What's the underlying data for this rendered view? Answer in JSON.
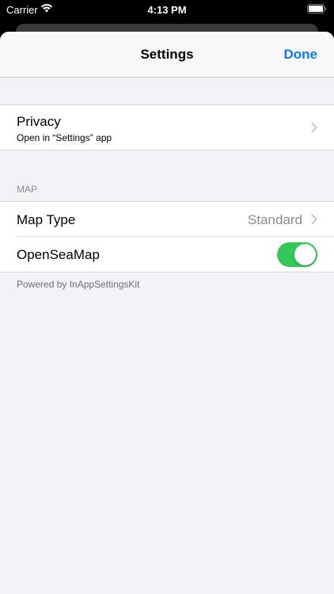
{
  "status_bar": {
    "carrier": "Carrier",
    "time": "4:13 PM",
    "icons": [
      "wifi-icon",
      "battery-icon"
    ]
  },
  "nav": {
    "title": "Settings",
    "done_label": "Done"
  },
  "privacy": {
    "title": "Privacy",
    "subtitle": "Open in “Settings” app",
    "icon": "chevron-right-icon"
  },
  "map_section": {
    "header": "MAP",
    "map_type": {
      "label": "Map Type",
      "value": "Standard",
      "icon": "chevron-right-icon"
    },
    "open_sea_map": {
      "label": "OpenSeaMap",
      "enabled": true
    }
  },
  "footer": "Powered by InAppSettingsKit",
  "colors": {
    "accent": "#0a7af5",
    "toggle_on": "#34c759",
    "background": "#f2f2f7",
    "secondary_text": "#8a8a8e"
  }
}
